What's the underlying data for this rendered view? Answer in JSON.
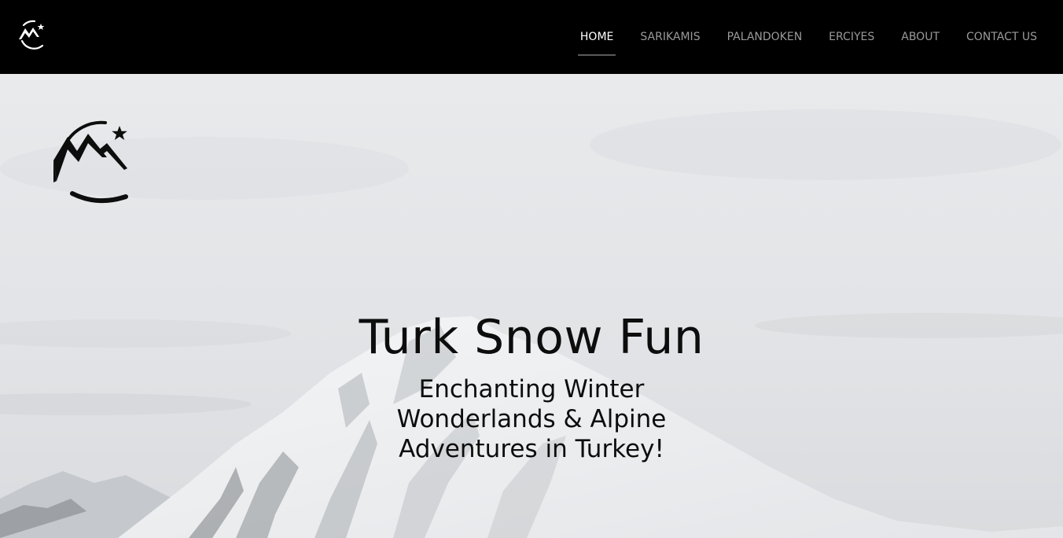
{
  "navbar": {
    "logo_icon": "mountain-star-logo-icon",
    "items": [
      {
        "label": "HOME",
        "active": true
      },
      {
        "label": "SARIKAMIS",
        "active": false
      },
      {
        "label": "PALANDOKEN",
        "active": false
      },
      {
        "label": "ERCIYES",
        "active": false
      },
      {
        "label": "ABOUT",
        "active": false
      },
      {
        "label": "CONTACT US",
        "active": false
      }
    ]
  },
  "hero": {
    "logo_icon": "mountain-star-logo-icon",
    "background": "snowy-mountain-peak",
    "title": "Turk Snow Fun",
    "tagline": "Enchanting Winter Wonderlands & Alpine Adventures in Turkey!"
  },
  "colors": {
    "navbar_bg": "#000000",
    "nav_active": "#ffffff",
    "nav_inactive": "#9a9a9a",
    "hero_text": "#0d0d0d"
  }
}
